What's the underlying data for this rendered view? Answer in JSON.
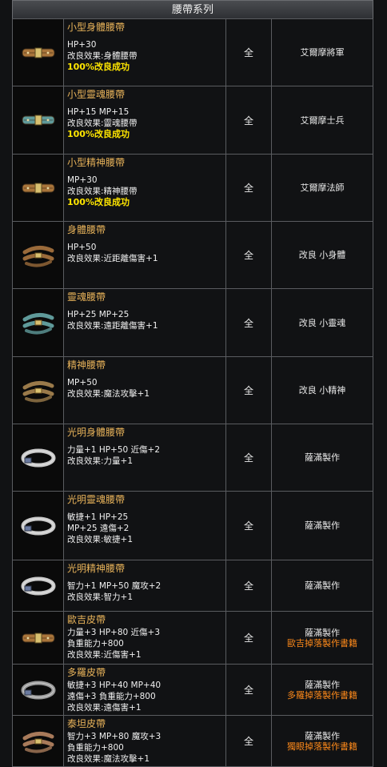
{
  "header": {
    "title": "腰帶系列"
  },
  "items": [
    {
      "name": "小型身體腰帶",
      "lines": [
        "HP+30",
        "改良效果:身體腰帶"
      ],
      "success": "100%改良成功",
      "class": "全",
      "source": [
        "艾爾摩將軍"
      ],
      "drop": "",
      "icon": "brown-belt-icon",
      "color": "#a8743a"
    },
    {
      "name": "小型靈魂腰帶",
      "lines": [
        "HP+15 MP+15",
        "改良效果:靈魂腰帶"
      ],
      "success": "100%改良成功",
      "class": "全",
      "source": [
        "艾爾摩士兵"
      ],
      "drop": "",
      "icon": "teal-belt-icon",
      "color": "#5f9a9a"
    },
    {
      "name": "小型精神腰帶",
      "lines": [
        "MP+30",
        "改良效果:精神腰帶"
      ],
      "success": "100%改良成功",
      "class": "全",
      "source": [
        "艾爾摩法師"
      ],
      "drop": "",
      "icon": "brown-belt-icon",
      "color": "#a8743a"
    },
    {
      "name": "身體腰帶",
      "lines": [
        "HP+50",
        "改良效果:近距離傷害+1"
      ],
      "success": "",
      "class": "全",
      "source": [
        "改良 小身體"
      ],
      "drop": "",
      "icon": "coiled-brown-belt-icon",
      "color": "#9a6a3a"
    },
    {
      "name": "靈魂腰帶",
      "lines": [
        "HP+25 MP+25",
        "改良效果:遠距離傷害+1"
      ],
      "success": "",
      "class": "全",
      "source": [
        "改良 小靈魂"
      ],
      "drop": "",
      "icon": "coiled-teal-belt-icon",
      "color": "#5f9a9a"
    },
    {
      "name": "精神腰帶",
      "lines": [
        "MP+50",
        "改良效果:魔法攻擊+1"
      ],
      "success": "",
      "class": "全",
      "source": [
        "改良 小精神"
      ],
      "drop": "",
      "icon": "coiled-brown-belt-icon",
      "color": "#9a7a4a"
    },
    {
      "name": "光明身體腰帶",
      "lines": [
        "力量+1 HP+50 近傷+2",
        "改良效果:力量+1"
      ],
      "success": "",
      "class": "全",
      "source": [
        "薩滿製作"
      ],
      "drop": "",
      "icon": "silver-belt-icon",
      "color": "#c8c8c8"
    },
    {
      "name": "光明靈魂腰帶",
      "lines": [
        "敏捷+1 HP+25",
        "MP+25 遠傷+2",
        "改良效果:敏捷+1"
      ],
      "success": "",
      "class": "全",
      "source": [
        "薩滿製作"
      ],
      "drop": "",
      "icon": "silver-belt-icon",
      "color": "#c8c8c8"
    },
    {
      "name": "光明精神腰帶",
      "lines": [
        "智力+1 MP+50 魔攻+2",
        "改良效果:智力+1"
      ],
      "success": "",
      "class": "全",
      "source": [
        "薩滿製作"
      ],
      "drop": "",
      "icon": "silver-belt-icon",
      "color": "#c8c8c8"
    },
    {
      "name": "歐吉皮帶",
      "lines": [
        "力量+3 HP+80 近傷+3",
        "負重能力+800",
        "改良效果:近傷害+1"
      ],
      "success": "",
      "class": "全",
      "source": [
        "薩滿製作"
      ],
      "drop": "歐吉掉落製作書籍",
      "icon": "brown-belt-icon",
      "color": "#a8743a"
    },
    {
      "name": "多羅皮帶",
      "lines": [
        "敏捷+3 HP+40 MP+40",
        "遠傷+3 負重能力+800",
        "改良效果:遠傷害+1"
      ],
      "success": "",
      "class": "全",
      "source": [
        "薩滿製作"
      ],
      "drop": "多羅掉落製作書籍",
      "icon": "silver-belt-icon",
      "color": "#9a9a9a"
    },
    {
      "name": "泰坦皮帶",
      "lines": [
        "智力+3 MP+80 魔攻+3",
        "負重能力+800",
        "改良效果:魔法攻擊+1"
      ],
      "success": "",
      "class": "全",
      "source": [
        "薩滿製作"
      ],
      "drop": "獨眼掉落製作書籍",
      "icon": "coiled-brown-belt-icon",
      "color": "#a87a5a"
    }
  ]
}
